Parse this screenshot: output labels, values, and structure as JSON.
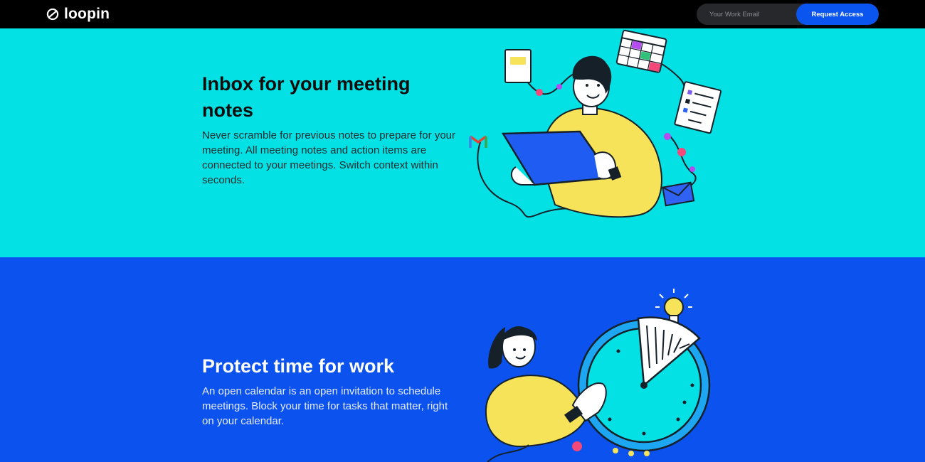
{
  "header": {
    "brand": "loopin",
    "email_placeholder": "Your Work Email",
    "cta_label": "Request Access"
  },
  "sections": [
    {
      "title": "Inbox for your meeting notes",
      "body": "Never scramble for previous notes to prepare for your meeting. All meeting notes and action items are connected to your meetings. Switch context within seconds."
    },
    {
      "title": "Protect time for work",
      "body": "An open calendar is an open invitation to schedule meetings. Block your time for tasks that matter, right on your calendar."
    }
  ],
  "colors": {
    "section_1_bg": "#04e1e4",
    "section_2_bg": "#0b52ee",
    "accent_blue": "#0a55f0",
    "illustration_yellow": "#f7e35a"
  }
}
